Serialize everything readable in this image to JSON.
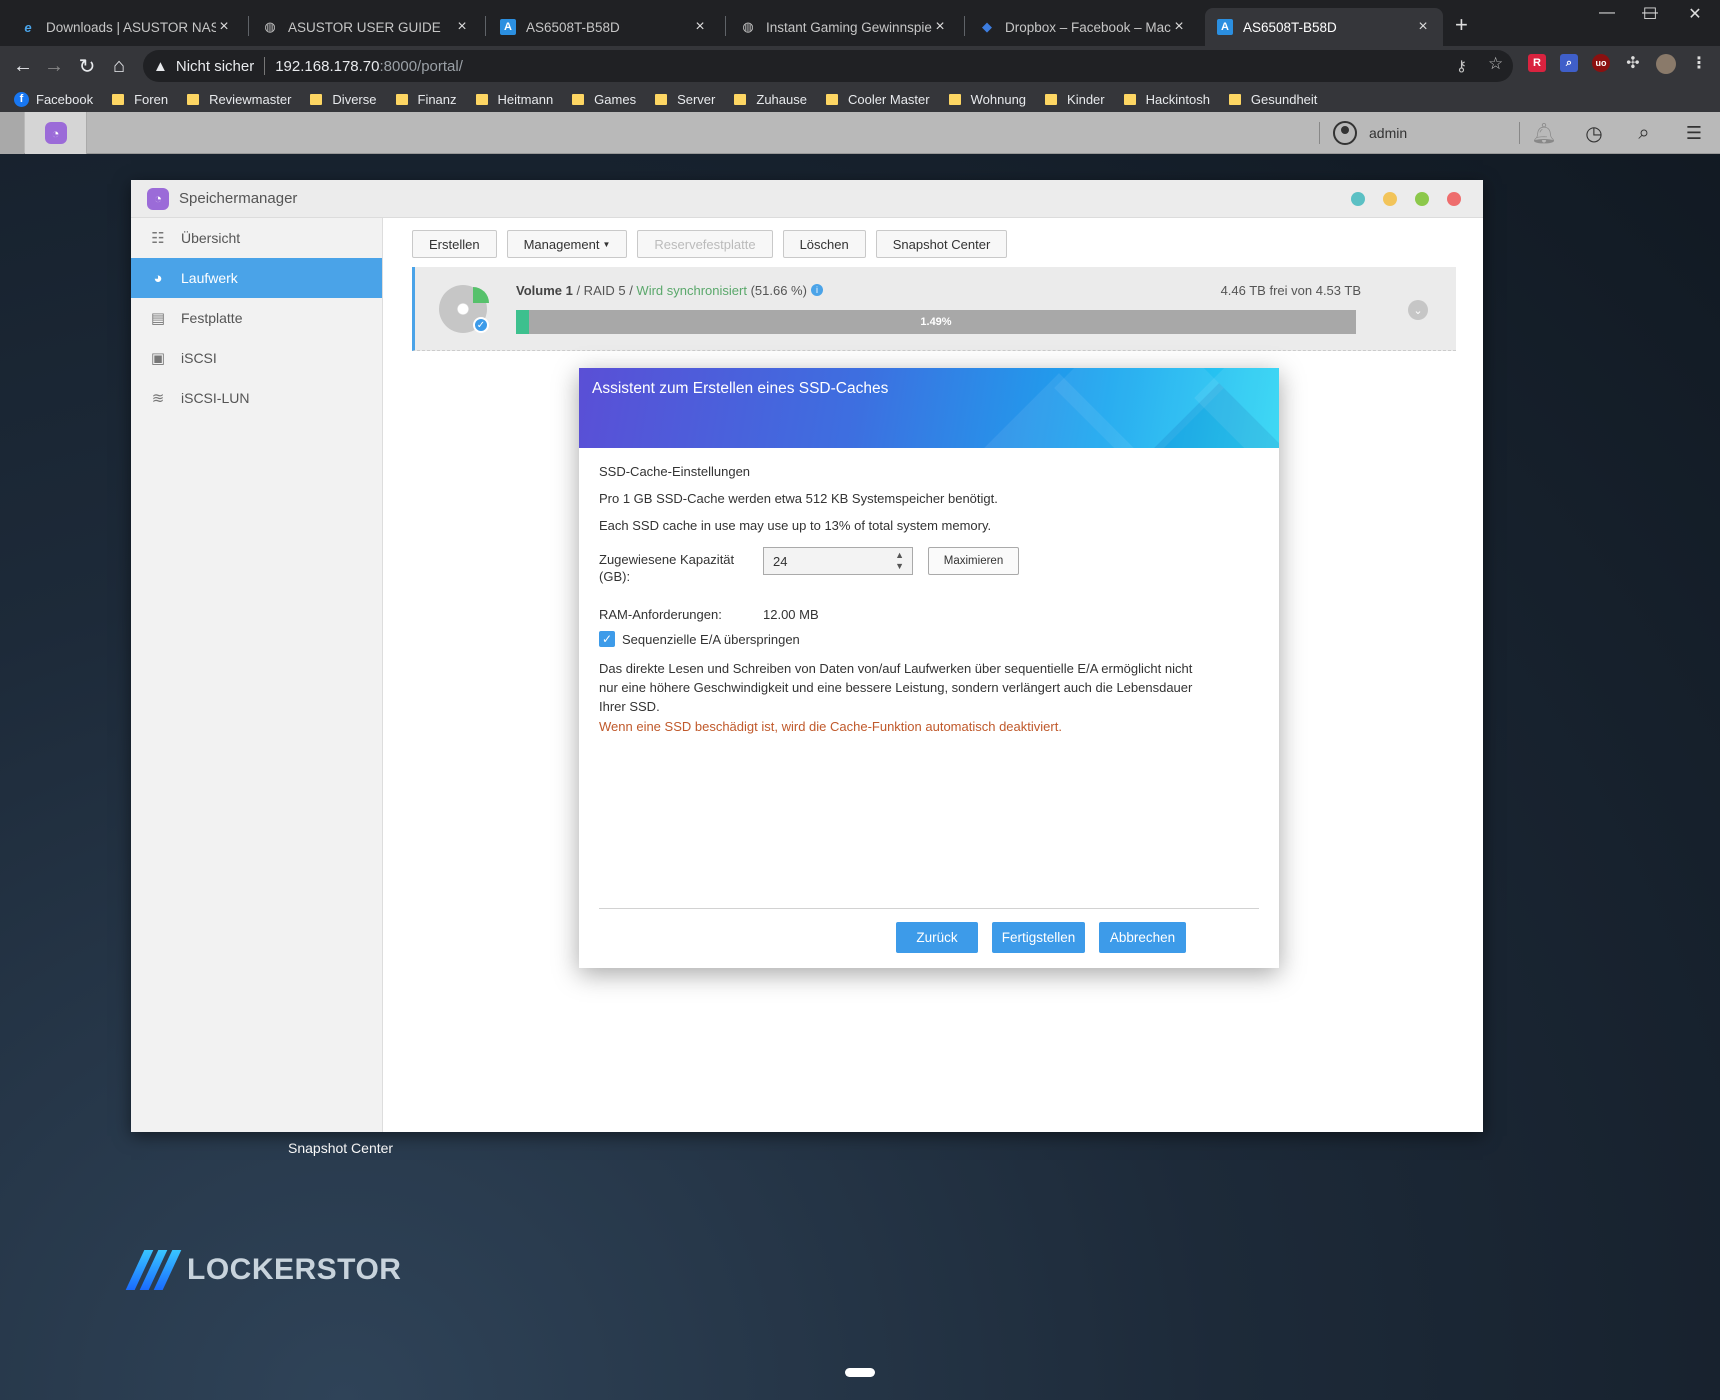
{
  "browser": {
    "tabs": [
      {
        "title": "Downloads | ASUSTOR NAS",
        "icon": "asustor-e-icon"
      },
      {
        "title": "ASUSTOR USER GUIDE",
        "icon": "globe-icon"
      },
      {
        "title": "AS6508T-B58D",
        "icon": "asustor-a-icon"
      },
      {
        "title": "Instant Gaming Gewinnspiel | Ha",
        "icon": "globe-icon"
      },
      {
        "title": "Dropbox – Facebook – Machen S",
        "icon": "dropbox-icon"
      },
      {
        "title": "AS6508T-B58D",
        "icon": "asustor-a-icon",
        "active": true
      }
    ],
    "address": {
      "warning": "Nicht sicher",
      "host": "192.168.178.70",
      "path": ":8000/portal/"
    },
    "bookmarks": [
      "Facebook",
      "Foren",
      "Reviewmaster",
      "Diverse",
      "Finanz",
      "Heitmann",
      "Games",
      "Server",
      "Zuhause",
      "Cooler Master",
      "Wohnung",
      "Kinder",
      "Hackintosh",
      "Gesundheit"
    ]
  },
  "nas": {
    "user": "admin",
    "desktop_label": "Snapshot Center",
    "brand": "LOCKERSTOR"
  },
  "app": {
    "title": "Speichermanager",
    "window_dots": [
      "#5bc0c4",
      "#f2c45a",
      "#8cc84b",
      "#ee6d6d"
    ],
    "sidebar": [
      {
        "label": "Übersicht",
        "icon": "list-icon"
      },
      {
        "label": "Laufwerk",
        "icon": "volume-icon",
        "active": true
      },
      {
        "label": "Festplatte",
        "icon": "disk-icon"
      },
      {
        "label": "iSCSI",
        "icon": "iscsi-icon"
      },
      {
        "label": "iSCSI-LUN",
        "icon": "database-icon"
      }
    ],
    "toolbar": {
      "create": "Erstellen",
      "management": "Management",
      "spare": "Reservefestplatte",
      "delete": "Löschen",
      "snapshot": "Snapshot Center"
    },
    "volume": {
      "name": "Volume 1",
      "raid": " / RAID 5 / ",
      "status": "Wird synchronisiert",
      "progress_text": " (51.66 %)",
      "free": "4.46 TB frei von 4.53 TB",
      "usage_label": "1.49%",
      "usage_percent": 1.49
    }
  },
  "dialog": {
    "title": "Assistent zum Erstellen eines SSD-Caches",
    "section": "SSD-Cache-Einstellungen",
    "line1": "Pro 1 GB SSD-Cache werden etwa 512 KB Systemspeicher benötigt.",
    "line2": "Each SSD cache in use may use up to 13% of total system memory.",
    "capacity_label": "Zugewiesene Kapazität (GB):",
    "capacity_value": "24",
    "maximize": "Maximieren",
    "ram_label": "RAM-Anforderungen:",
    "ram_value": "12.00 MB",
    "skip_seq_label": "Sequenzielle E/A überspringen",
    "skip_seq_checked": true,
    "description": "Das direkte Lesen und Schreiben von Daten von/auf Laufwerken über sequentielle E/A ermöglicht nicht nur eine höhere Geschwindigkeit und eine bessere Leistung, sondern verlängert auch die Lebensdauer Ihrer SSD.",
    "warning": "Wenn eine SSD beschädigt ist, wird die Cache-Funktion automatisch deaktiviert.",
    "warning_color": "#c0592b",
    "buttons": {
      "back": "Zurück",
      "finish": "Fertigstellen",
      "cancel": "Abbrechen"
    }
  }
}
